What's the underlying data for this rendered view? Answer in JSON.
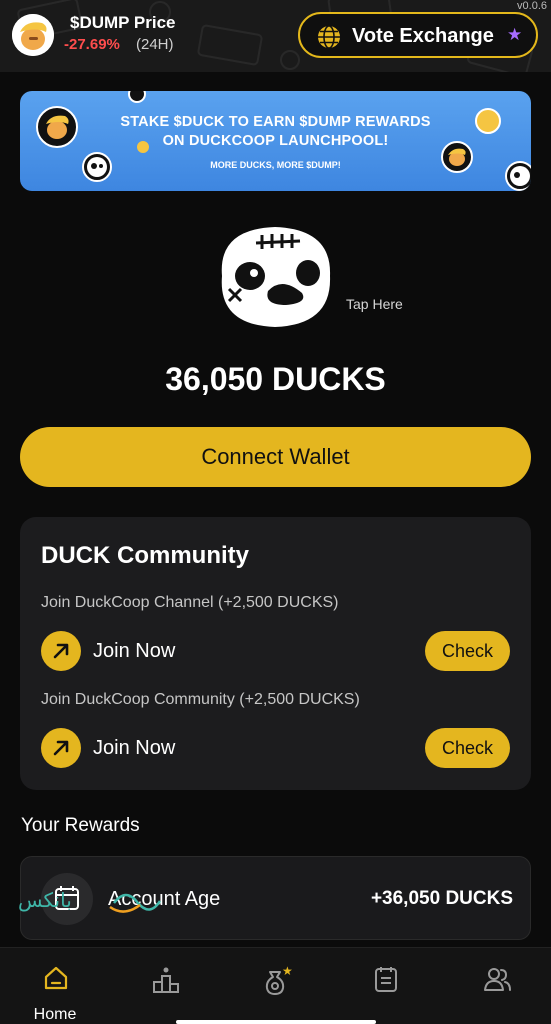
{
  "header": {
    "version": "v0.0.6",
    "price_title": "$DUMP Price",
    "price_change": "-27.69%",
    "price_period": "(24H)",
    "vote_label": "Vote Exchange"
  },
  "banner": {
    "line1": "STAKE $DUCK TO EARN $DUMP REWARDS",
    "line2": "ON DUCKCOOP LAUNCHPOOL!",
    "sub": "MORE DUCKS, MORE $DUMP!"
  },
  "mascot": {
    "tap_hint": "Tap Here"
  },
  "balance": "36,050 DUCKS",
  "connect_label": "Connect Wallet",
  "community": {
    "title": "DUCK Community",
    "tasks": [
      {
        "label": "Join DuckCoop Channel (+2,500 DUCKS)",
        "action": "Join Now",
        "check": "Check"
      },
      {
        "label": "Join DuckCoop Community (+2,500 DUCKS)",
        "action": "Join Now",
        "check": "Check"
      }
    ]
  },
  "rewards": {
    "title": "Your Rewards",
    "items": [
      {
        "label": "Account Age",
        "value": "+36,050 DUCKS"
      }
    ]
  },
  "watermark_text": "بانكس",
  "nav": {
    "items": [
      {
        "label": "Home",
        "icon": "home-icon",
        "active": true
      },
      {
        "label": "",
        "icon": "leaderboard-icon",
        "active": false
      },
      {
        "label": "",
        "icon": "money-bag-icon",
        "active": false
      },
      {
        "label": "",
        "icon": "tasks-icon",
        "active": false
      },
      {
        "label": "",
        "icon": "friends-icon",
        "active": false
      }
    ]
  },
  "colors": {
    "accent": "#e4b61f",
    "negative": "#ff4d4d",
    "banner": "#4a93e8",
    "star": "#a66bff"
  }
}
